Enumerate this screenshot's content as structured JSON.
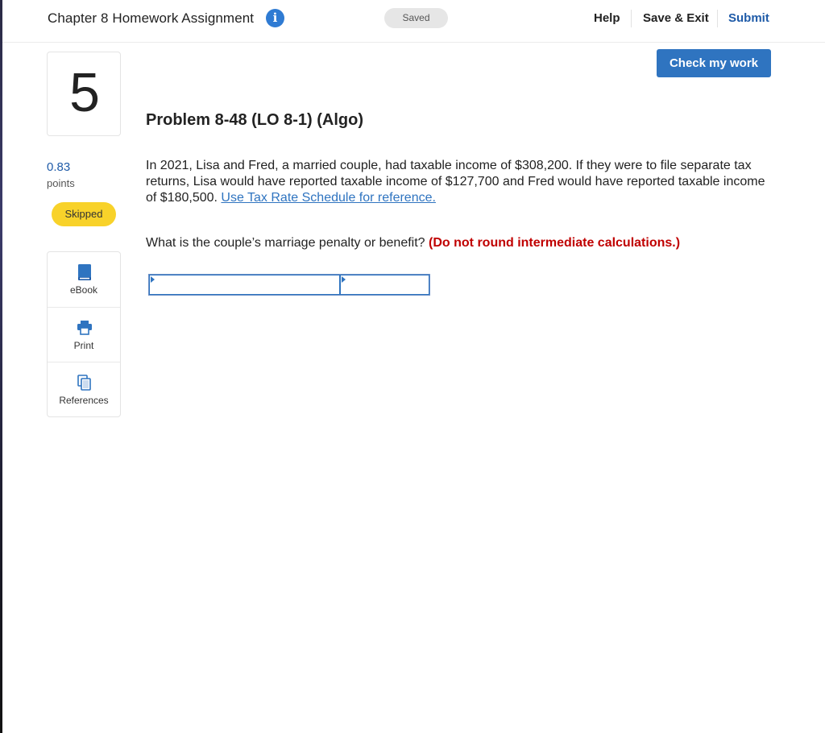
{
  "header": {
    "assignment_title": "Chapter 8 Homework Assignment",
    "save_status": "Saved",
    "help_label": "Help",
    "save_exit_label": "Save & Exit",
    "submit_label": "Submit"
  },
  "question": {
    "number": "5",
    "points_value": "0.83",
    "points_label": "points",
    "status": "Skipped",
    "check_button_label": "Check my work",
    "title": "Problem 8-48 (LO 8-1) (Algo)",
    "body": "In 2021, Lisa and Fred, a married couple, had taxable income of $308,200. If they were to file separate tax returns, Lisa would have reported taxable income of $127,700 and Fred would have reported taxable income of $180,500.",
    "reference_link": "Use Tax Rate Schedule for reference.",
    "prompt": "What is the couple’s marriage penalty or benefit?",
    "instruction": "(Do not round intermediate calculations.)",
    "answer_1_value": "",
    "answer_2_value": ""
  },
  "tools": [
    {
      "label": "eBook",
      "icon": "book-icon"
    },
    {
      "label": "Print",
      "icon": "printer-icon"
    },
    {
      "label": "References",
      "icon": "references-icon"
    }
  ],
  "colors": {
    "brand_blue": "#2f74c0",
    "link_blue": "#1f5ba8",
    "skipped_yellow": "#f8d22a",
    "instruction_red": "#c00000"
  }
}
